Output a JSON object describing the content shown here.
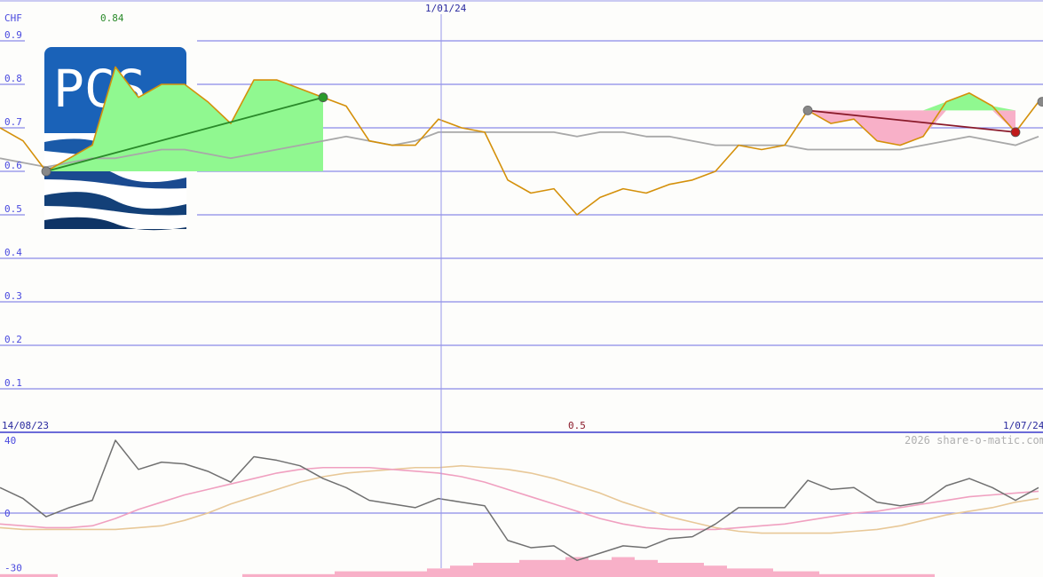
{
  "chart_data": [
    {
      "type": "line",
      "title": "",
      "currency_label": "CHF",
      "top_value_label": "0.84",
      "ylim": [
        0.05,
        0.95
      ],
      "y_ticks": [
        0.1,
        0.2,
        0.3,
        0.4,
        0.5,
        0.6,
        0.7,
        0.8,
        0.9
      ],
      "date_labels": {
        "start": "14/08/23",
        "mid": "1/01/24",
        "end": "1/07/24"
      },
      "logo_text": "PCS",
      "series": [
        {
          "role": "price",
          "color": "#d4900a",
          "values": [
            0.7,
            0.67,
            0.6,
            0.63,
            0.66,
            0.84,
            0.77,
            0.8,
            0.8,
            0.76,
            0.71,
            0.81,
            0.81,
            0.79,
            0.77,
            0.75,
            0.67,
            0.66,
            0.66,
            0.72,
            0.7,
            0.69,
            0.58,
            0.55,
            0.56,
            0.5,
            0.54,
            0.56,
            0.55,
            0.57,
            0.58,
            0.6,
            0.66,
            0.65,
            0.66,
            0.74,
            0.71,
            0.72,
            0.67,
            0.66,
            0.68,
            0.76,
            0.78,
            0.75,
            0.69,
            0.76
          ]
        },
        {
          "role": "average",
          "color": "#a8a8a8",
          "values": [
            0.63,
            0.62,
            0.61,
            0.62,
            0.63,
            0.63,
            0.64,
            0.65,
            0.65,
            0.64,
            0.63,
            0.64,
            0.65,
            0.66,
            0.67,
            0.68,
            0.67,
            0.66,
            0.67,
            0.69,
            0.69,
            0.69,
            0.69,
            0.69,
            0.69,
            0.68,
            0.69,
            0.69,
            0.68,
            0.68,
            0.67,
            0.66,
            0.66,
            0.66,
            0.66,
            0.65,
            0.65,
            0.65,
            0.65,
            0.65,
            0.66,
            0.67,
            0.68,
            0.67,
            0.66,
            0.68
          ]
        }
      ],
      "trend_lines": [
        {
          "from": [
            2,
            0.6
          ],
          "to": [
            14,
            0.77
          ],
          "color": "#2a8a2a",
          "start_marker": "#888888",
          "end_marker": "#2a9a2a"
        },
        {
          "from": [
            35,
            0.74
          ],
          "to": [
            44,
            0.69
          ],
          "color": "#8a1a2a",
          "start_marker": "#888888",
          "end_marker": "#c01a1a"
        }
      ],
      "end_marker_value": 0.76,
      "fill_colors": {
        "gain": "#90f890",
        "loss": "#f8b0c8"
      }
    },
    {
      "type": "line",
      "ylim": [
        -30,
        40
      ],
      "y_ticks": [
        40,
        0,
        -30
      ],
      "mid_label": "0.5",
      "watermark": "2026 share-o-matic.com",
      "series": [
        {
          "role": "oscillator",
          "color": "#707070",
          "values": [
            14,
            8,
            -2,
            3,
            7,
            40,
            24,
            28,
            27,
            23,
            17,
            31,
            29,
            26,
            19,
            14,
            7,
            5,
            3,
            8,
            6,
            4,
            -15,
            -19,
            -18,
            -26,
            -22,
            -18,
            -19,
            -14,
            -13,
            -6,
            3,
            3,
            3,
            18,
            13,
            14,
            6,
            4,
            6,
            15,
            19,
            14,
            7,
            14
          ]
        },
        {
          "role": "signal",
          "color": "#f0a0c0",
          "values": [
            -6,
            -7,
            -8,
            -8,
            -7,
            -3,
            2,
            6,
            10,
            13,
            16,
            19,
            22,
            24,
            25,
            25,
            25,
            24,
            23,
            22,
            20,
            17,
            13,
            9,
            5,
            1,
            -3,
            -6,
            -8,
            -9,
            -9,
            -9,
            -8,
            -7,
            -6,
            -4,
            -2,
            0,
            1,
            3,
            5,
            7,
            9,
            10,
            11,
            12
          ]
        },
        {
          "role": "slow",
          "color": "#e8c898",
          "values": [
            -8,
            -9,
            -9,
            -9,
            -9,
            -9,
            -8,
            -7,
            -4,
            0,
            5,
            9,
            13,
            17,
            20,
            22,
            23,
            24,
            25,
            25,
            26,
            25,
            24,
            22,
            19,
            15,
            11,
            6,
            2,
            -2,
            -5,
            -8,
            -10,
            -11,
            -11,
            -11,
            -11,
            -10,
            -9,
            -7,
            -4,
            -1,
            1,
            3,
            6,
            8
          ]
        }
      ],
      "volume": {
        "color": "#f8b0c8",
        "values": [
          1,
          1,
          1,
          0,
          0,
          0,
          0,
          0,
          0,
          0,
          0,
          1,
          1,
          1,
          1,
          2,
          2,
          2,
          2,
          3,
          4,
          5,
          5,
          6,
          6,
          7,
          6,
          7,
          6,
          5,
          5,
          4,
          3,
          3,
          2,
          2,
          1,
          1,
          1,
          1,
          1,
          0,
          0,
          0,
          0,
          0
        ]
      }
    }
  ]
}
